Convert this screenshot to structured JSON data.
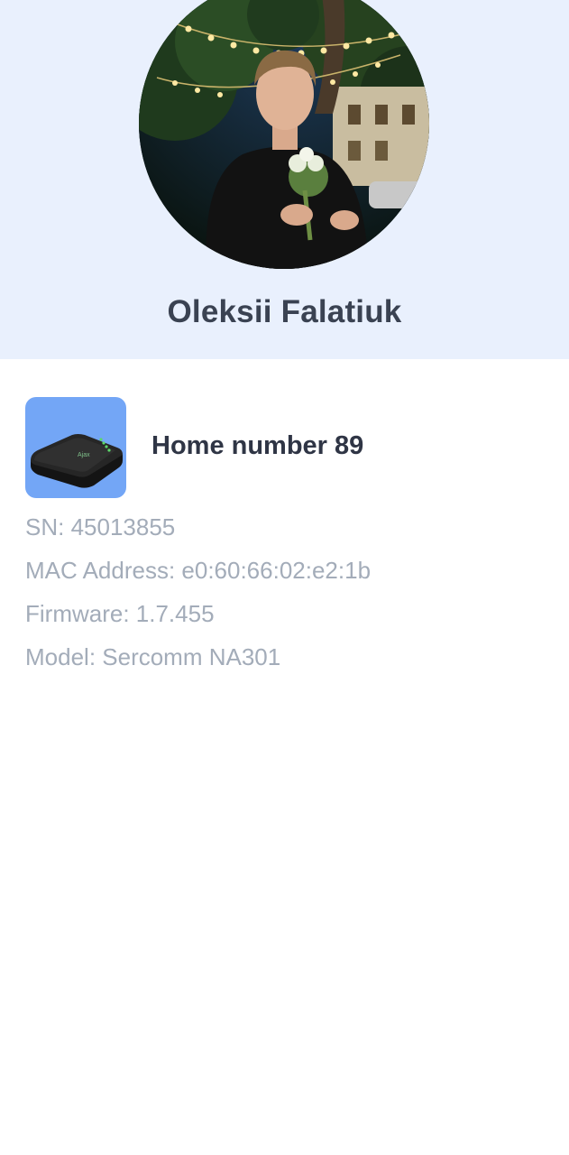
{
  "profile": {
    "name": "Oleksii Falatiuk",
    "avatar_icon": "user-photo"
  },
  "device": {
    "title": "Home number 89",
    "thumb_icon": "router-icon",
    "info": {
      "sn": "SN: 45013855",
      "mac": "MAC Address: e0:60:66:02:e2:1b",
      "firmware": "Firmware: 1.7.455",
      "model": "Model: Sercomm NA301"
    }
  },
  "colors": {
    "header_bg": "#e9f0fd",
    "name_text": "#3a4252",
    "device_thumb_bg": "#73a6f6",
    "info_text": "#a3acb9"
  }
}
